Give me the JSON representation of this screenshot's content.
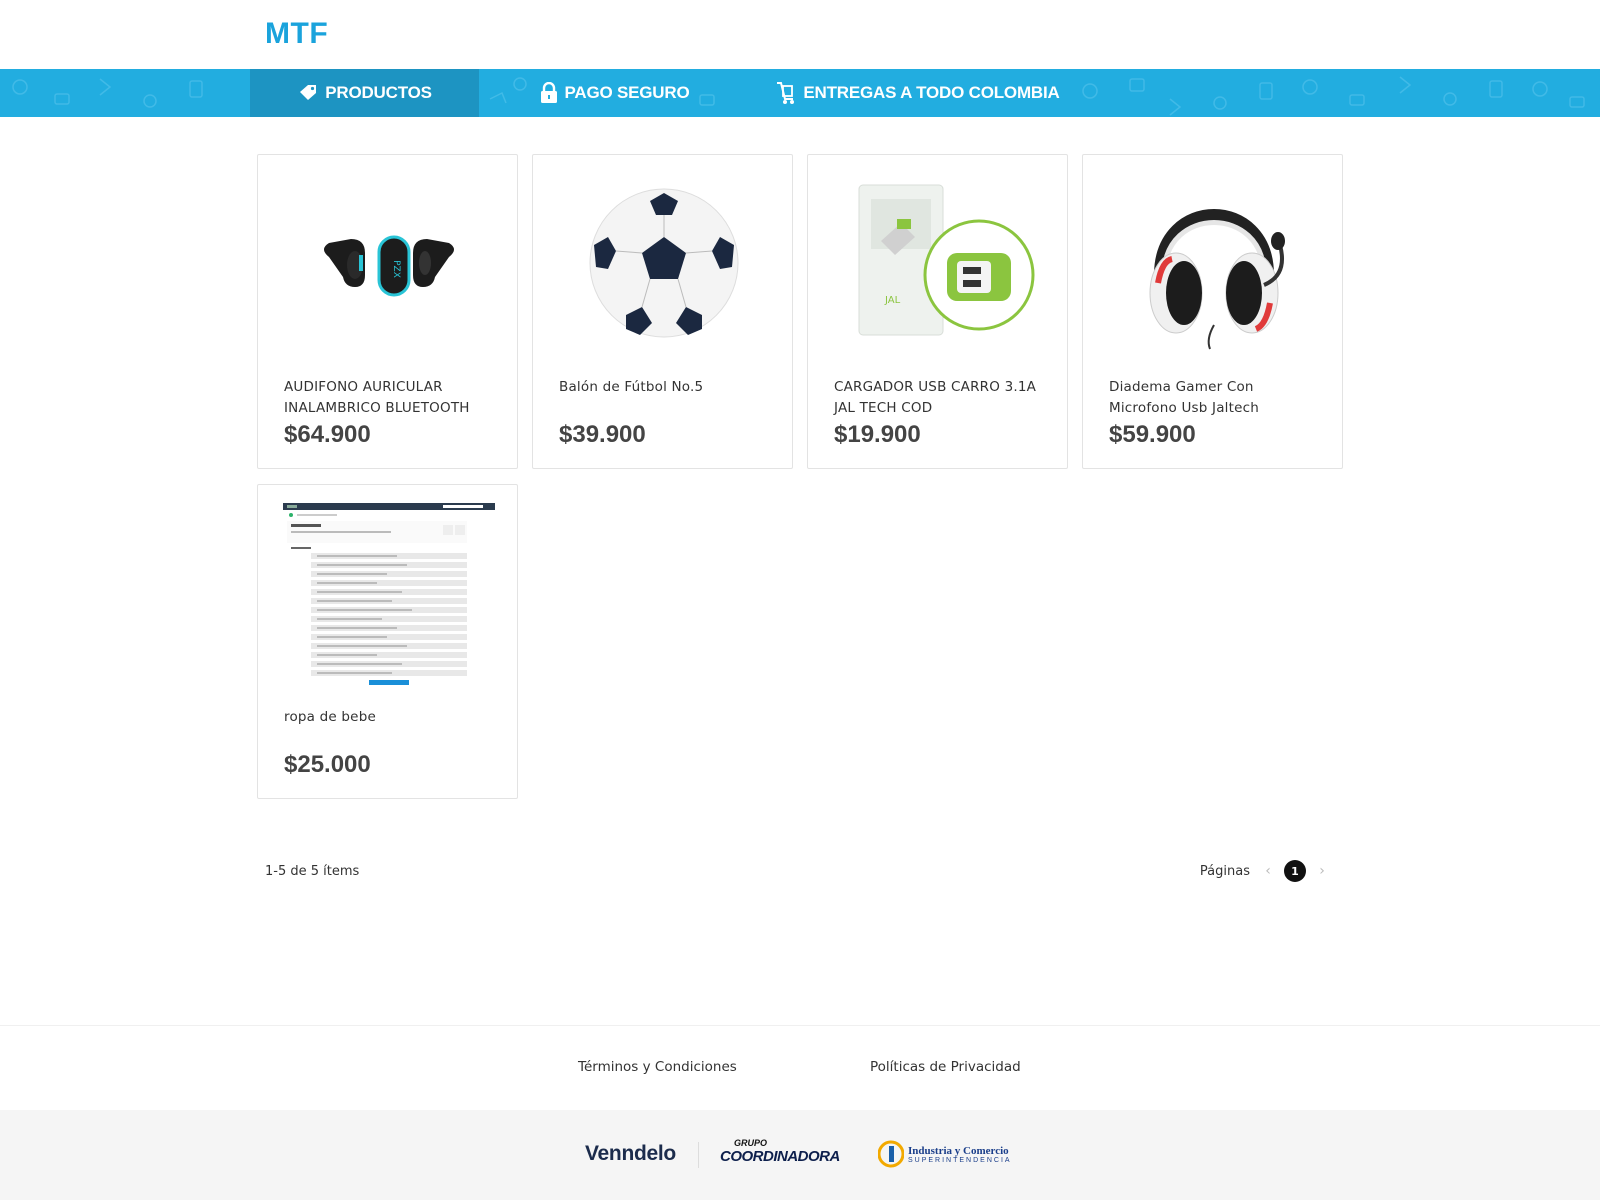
{
  "header": {
    "logo": "MTF"
  },
  "nav": {
    "items": [
      {
        "label": "PRODUCTOS",
        "icon": "tag-icon",
        "active": true
      },
      {
        "label": "PAGO SEGURO",
        "icon": "lock-icon",
        "active": false
      },
      {
        "label": "ENTREGAS A TODO COLOMBIA",
        "icon": "delivery-icon",
        "active": false
      }
    ],
    "colors": {
      "bar": "#22ade0",
      "active": "#1d94c2"
    }
  },
  "products": [
    {
      "name": "AUDIFONO AURICULAR INALAMBRICO BLUETOOTH",
      "price": "$64.900",
      "image": "earbuds"
    },
    {
      "name": "Balón de Fútbol No.5",
      "price": "$39.900",
      "image": "soccer-ball"
    },
    {
      "name": "CARGADOR USB CARRO 3.1A JAL TECH COD",
      "price": "$19.900",
      "image": "usb-car-charger"
    },
    {
      "name": "Diadema Gamer Con Microfono Usb Jaltech",
      "price": "$59.900",
      "image": "gaming-headset"
    },
    {
      "name": "ropa de bebe",
      "price": "$25.000",
      "image": "screenshot-thumbnail"
    }
  ],
  "listing": {
    "count_text": "1-5 de 5 ítems",
    "pages_label": "Páginas",
    "current_page": "1"
  },
  "footer": {
    "terms": "Términos y Condiciones",
    "privacy": "Políticas de Privacidad",
    "brands": {
      "vendelo": "Venndelo",
      "grupo": "GRUPO",
      "coordinadora": "COORDINADORA",
      "sic_line1": "Industria y Comercio",
      "sic_line2": "SUPERINTENDENCIA"
    }
  }
}
